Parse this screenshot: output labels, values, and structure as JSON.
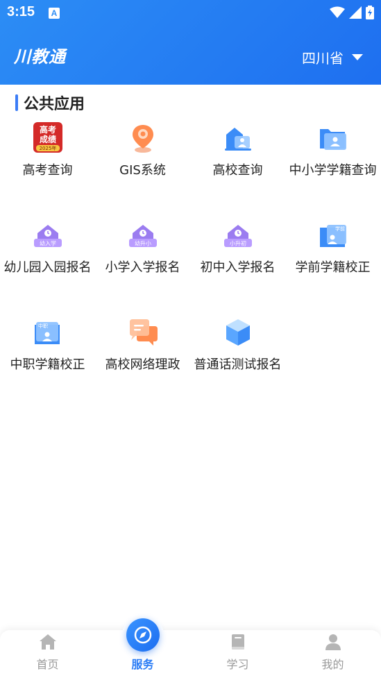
{
  "status": {
    "time": "3:15",
    "notif_icon": "A"
  },
  "header": {
    "logo": "川教通",
    "region": "四川省"
  },
  "section": {
    "title": "公共应用"
  },
  "apps": [
    {
      "label": "高考查询",
      "badge": [
        "高考",
        "成绩",
        "2025年"
      ]
    },
    {
      "label": "GIS系统"
    },
    {
      "label": "高校查询"
    },
    {
      "label": "中小学学籍查询"
    },
    {
      "label": "幼儿园入园报名",
      "badge": "幼入学"
    },
    {
      "label": "小学入学报名",
      "badge": "幼升小"
    },
    {
      "label": "初中入学报名",
      "badge": "小升初"
    },
    {
      "label": "学前学籍校正",
      "badge": "学前"
    },
    {
      "label": "中职学籍校正",
      "badge": "中职"
    },
    {
      "label": "高校网络理政"
    },
    {
      "label": "普通话测试报名"
    }
  ],
  "tabs": [
    {
      "label": "首页"
    },
    {
      "label": "服务"
    },
    {
      "label": "学习"
    },
    {
      "label": "我的"
    }
  ],
  "colors": {
    "primary": "#2a7cf5",
    "header": "#1e78f2",
    "inactive": "#999999"
  }
}
